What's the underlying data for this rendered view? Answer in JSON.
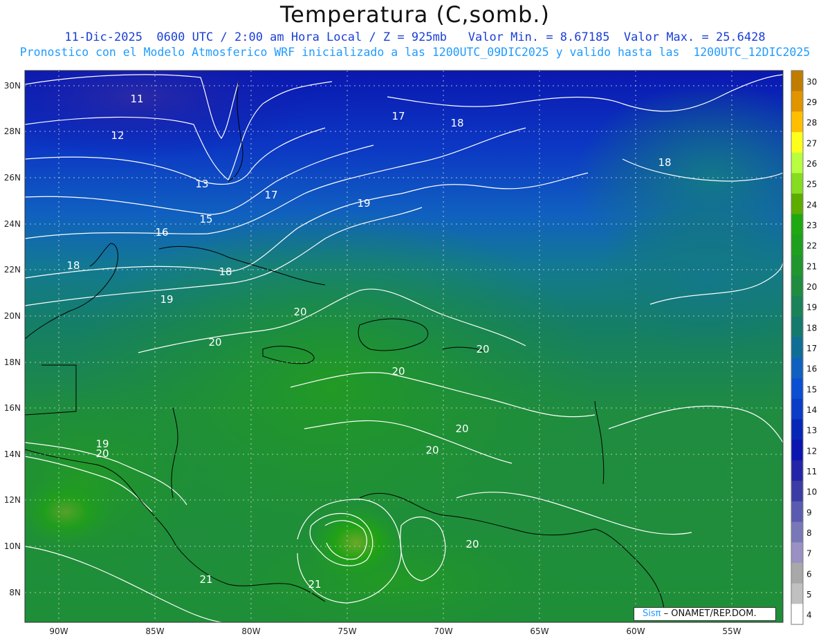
{
  "header": {
    "title": "Temperatura (C,somb.)",
    "subtitle_line1": "11-Dic-2025  0600 UTC / 2:00 am Hora Local / Z = 925mb   Valor Min. = 8.67185  Valor Max. = 25.6428",
    "subtitle_line2": "Pronostico con el Modelo Atmosferico WRF inicializado a las 1200UTC_09DIC2025 y valido hasta las  1200UTC_12DIC2025"
  },
  "map": {
    "lat_labels": [
      "30N",
      "28N",
      "26N",
      "24N",
      "22N",
      "20N",
      "18N",
      "16N",
      "14N",
      "12N",
      "10N",
      "8N"
    ],
    "lon_labels": [
      "90W",
      "85W",
      "80W",
      "75W",
      "70W",
      "65W",
      "60W",
      "55W"
    ],
    "contour_labels": [
      {
        "text": "11"
      },
      {
        "text": "12"
      },
      {
        "text": "13"
      },
      {
        "text": "15"
      },
      {
        "text": "16"
      },
      {
        "text": "17"
      },
      {
        "text": "17"
      },
      {
        "text": "18"
      },
      {
        "text": "18"
      },
      {
        "text": "18"
      },
      {
        "text": "18"
      },
      {
        "text": "19"
      },
      {
        "text": "19"
      },
      {
        "text": "19"
      },
      {
        "text": "20"
      },
      {
        "text": "20"
      },
      {
        "text": "20"
      },
      {
        "text": "20"
      },
      {
        "text": "20"
      },
      {
        "text": "20"
      },
      {
        "text": "20"
      },
      {
        "text": "20"
      },
      {
        "text": "21"
      },
      {
        "text": "21"
      }
    ]
  },
  "colorbar": {
    "levels": [
      "30",
      "29",
      "28",
      "27",
      "26",
      "25",
      "24",
      "23",
      "22",
      "21",
      "20",
      "19",
      "18",
      "17",
      "16",
      "15",
      "14",
      "13",
      "12",
      "11",
      "10",
      "9",
      "8",
      "7",
      "6",
      "5",
      "4"
    ],
    "colors": [
      "#c07c00",
      "#e09400",
      "#ffbf00",
      "#ffff1c",
      "#b8ff40",
      "#86dd20",
      "#5dac00",
      "#1fa810",
      "#1ea01e",
      "#1f962e",
      "#1f8c40",
      "#1a8258",
      "#147a6e",
      "#0f6e96",
      "#1060c0",
      "#0c4ed2",
      "#0a3cc8",
      "#0626b8",
      "#0a14b0",
      "#2424a8",
      "#3c3ca6",
      "#5a5ab0",
      "#7878b8",
      "#9a90c4",
      "#a8a8a8",
      "#c0c0c0",
      "#ffffff"
    ]
  },
  "credit": {
    "brand": "Sisπ",
    "text": " – ONAMET/REP.DOM."
  }
}
